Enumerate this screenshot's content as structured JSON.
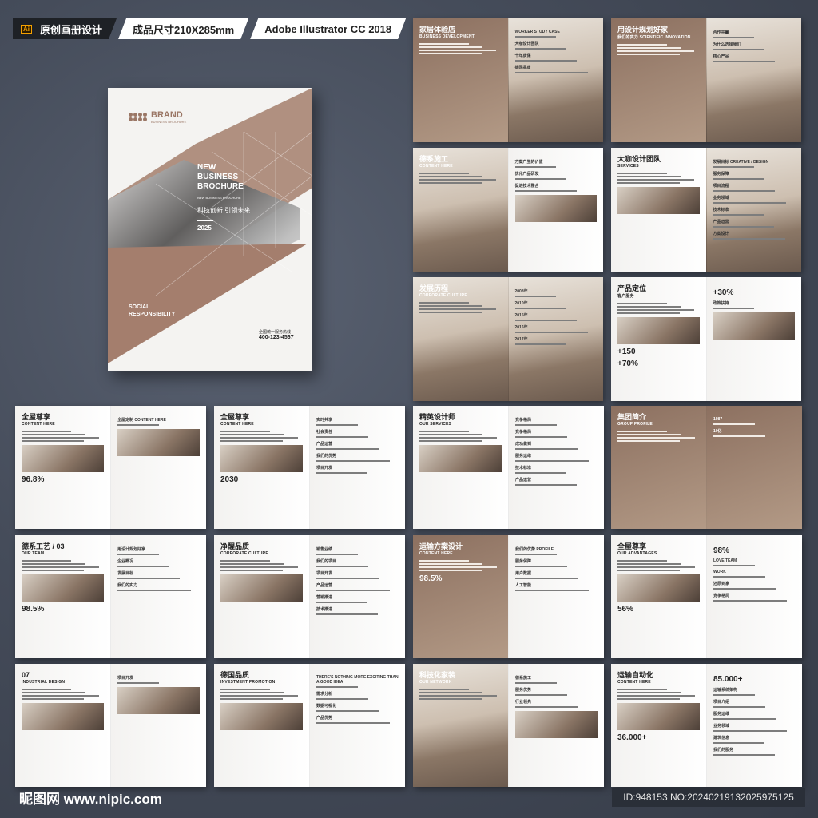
{
  "header": {
    "ai_badge": "Ai",
    "tag1": "原创画册设计",
    "tag2": "成品尺寸210X285mm",
    "tag3": "Adobe Illustrator CC 2018"
  },
  "cover": {
    "brand": "BRAND",
    "brand_sub": "BUSINESS BROCHURE",
    "title_lines": [
      "NEW",
      "BUSINESS",
      "BROCHURE"
    ],
    "subtitle": "NEW BUSINESS BROCHURE",
    "slogan": "科技创新 引领未来",
    "year": "2025",
    "social_lines": [
      "SOCIAL",
      "RESPONSIBILITY"
    ],
    "hotline_label": "全国统一服务热线",
    "hotline": "400-123-4567"
  },
  "spreads": [
    {
      "title": "家居体验店",
      "subtitle": "BUSINESS DEVELOPMENT",
      "labels": [
        "WORKER  STUDY  CASE",
        "大咖设计团队",
        "十年质保",
        "德国品质"
      ],
      "stats": []
    },
    {
      "title": "用设计规划好家",
      "subtitle": "我们的实力 SCIENTIFIC INNOVATION",
      "labels": [
        "合作共赢",
        "为什么选择我们",
        "核心产品"
      ],
      "stats": []
    },
    {
      "title": "德系施工",
      "subtitle": "CONTENT HERE",
      "labels": [
        "方案产生的价值",
        "优化产品研发",
        "促进技术整合"
      ],
      "stats": []
    },
    {
      "title": "大咖设计团队",
      "subtitle": "SERVICES",
      "labels": [
        "发展目标 CREATIVE / DESIGN",
        "服务保障",
        "项目流程",
        "业务领域",
        "技术标准",
        "产品运营",
        "方案设计"
      ],
      "stats": []
    },
    {
      "title": "发展历程",
      "subtitle": "CORPORATE CULTURE",
      "labels": [
        "2008年",
        "2010年",
        "2015年",
        "2016年",
        "2017年"
      ],
      "stats": []
    },
    {
      "title": "产品定位",
      "subtitle": "客户服务",
      "labels": [
        "政策扶持"
      ],
      "stats": [
        "+150",
        "+30%",
        "+70%"
      ]
    },
    {
      "title": "全屋尊享",
      "subtitle": "CONTENT HERE",
      "labels": [
        "全屋定制 CONTENT HERE"
      ],
      "stats": [
        "96.8%"
      ]
    },
    {
      "title": "全屋尊享",
      "subtitle": "CONTENT HERE",
      "labels": [
        "实时共享",
        "社会责任",
        "产品运营",
        "我们的优势",
        "项目开发"
      ],
      "stats": [
        "2030"
      ]
    },
    {
      "title": "精英设计师",
      "subtitle": "OUR SERVICES",
      "labels": [
        "竞争格局",
        "竞争格局",
        "成功做到",
        "服务运维",
        "技术标准",
        "产品运营"
      ],
      "stats": []
    },
    {
      "title": "集团简介",
      "subtitle": "GROUP PROFILE",
      "labels": [
        "1987",
        "10亿"
      ],
      "stats": []
    },
    {
      "title": "德系工艺 / 03",
      "subtitle": "OUR TEAM",
      "labels": [
        "用设计规划好家",
        "企业概况",
        "发展目标",
        "我们的实力"
      ],
      "stats": [
        "98.5%"
      ]
    },
    {
      "title": "净醒品质",
      "subtitle": "CORPORATE CULTURE",
      "labels": [
        "销售业绩",
        "我们的项目",
        "项目开发",
        "产品运营",
        "营销推进",
        "技术推进"
      ],
      "stats": []
    },
    {
      "title": "运输方案设计",
      "subtitle": "CONTENT HERE",
      "labels": [
        "我们的优势 PROFILE",
        "服务保障",
        "用户数据",
        "人工智能"
      ],
      "stats": [
        "98.5%"
      ]
    },
    {
      "title": "全屋尊享",
      "subtitle": "OUR ADVANTAGES",
      "labels": [
        "LOVE TEAM",
        "WORK",
        "还原到家",
        "竞争格局"
      ],
      "stats": [
        "56%",
        "98%"
      ]
    },
    {
      "title": "07",
      "subtitle": "INDUSTRIAL DESIGN",
      "labels": [
        "项目开发"
      ],
      "stats": []
    },
    {
      "title": "德国品质",
      "subtitle": "INVESTMENT PROMOTION",
      "labels": [
        "THERE'S NOTHING MORE EXCITING THAN A GOOD IDEA",
        "需求分析",
        "数据可视化",
        "产品优势"
      ],
      "stats": []
    },
    {
      "title": "科技化家装",
      "subtitle": "OUR NETWORK",
      "labels": [
        "德系施工",
        "服务优势",
        "行业领先"
      ],
      "stats": []
    },
    {
      "title": "运输自动化",
      "subtitle": "CONTENT HERE",
      "labels": [
        "运输系统架构",
        "项目介绍",
        "服务运维",
        "业务领域",
        "建筑信息",
        "我们的服务"
      ],
      "stats": [
        "36.000+",
        "85.000+"
      ]
    }
  ],
  "footer": {
    "watermark": "昵图网 www.nipic.com",
    "id": "ID:948153 NO:20240219132025975125"
  }
}
